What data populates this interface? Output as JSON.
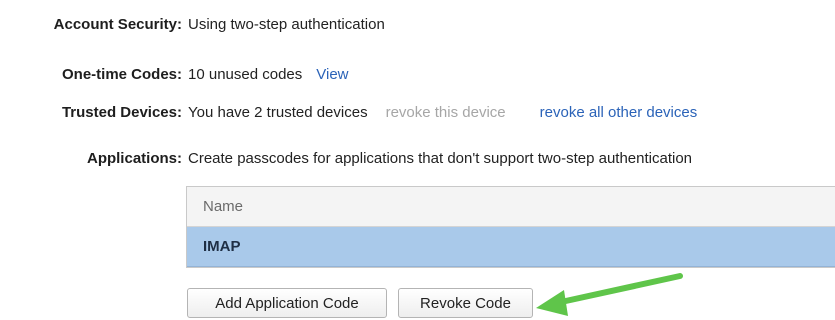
{
  "account_security": {
    "label": "Account Security:",
    "value": "Using two-step authentication"
  },
  "one_time_codes": {
    "label": "One-time Codes:",
    "value": "10 unused codes",
    "view_link": "View"
  },
  "trusted_devices": {
    "label": "Trusted Devices:",
    "value": "You have 2 trusted devices",
    "revoke_this_link": "revoke this device",
    "revoke_all_link": "revoke all other devices"
  },
  "applications": {
    "label": "Applications:",
    "value": "Create passcodes for applications that don't support two-step authentication",
    "table": {
      "header": "Name",
      "rows": [
        "IMAP"
      ]
    },
    "add_button": "Add Application Code",
    "revoke_button": "Revoke Code"
  },
  "colors": {
    "link": "#2b63b8",
    "disabled_link": "#a6a6a6",
    "selected_row": "#a9c9ea",
    "annotation_arrow": "#5fc54a"
  },
  "annotation": {
    "icon": "green-arrow-icon"
  }
}
